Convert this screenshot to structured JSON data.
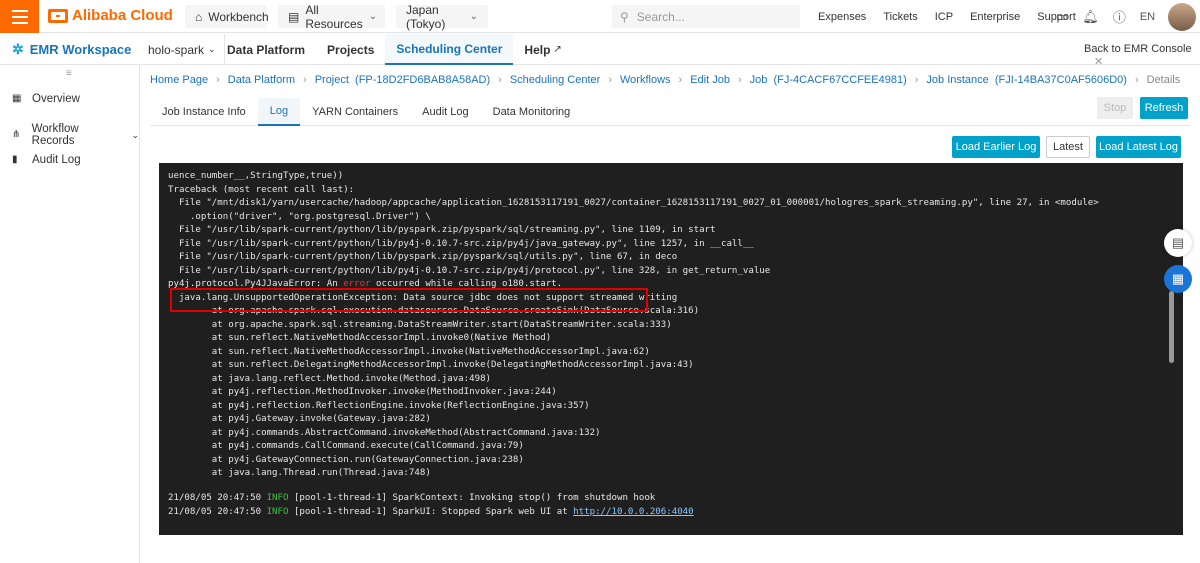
{
  "topbar": {
    "brand": "Alibaba Cloud",
    "workbench": "Workbench",
    "resources": "All Resources",
    "region": "Japan (Tokyo)",
    "search_placeholder": "Search...",
    "links": [
      "Expenses",
      "Tickets",
      "ICP",
      "Enterprise",
      "Support"
    ],
    "lang": "EN"
  },
  "secbar": {
    "product": "EMR Workspace",
    "workspace": "holo-spark",
    "tabs": [
      "Data Platform",
      "Projects",
      "Scheduling Center",
      "Help"
    ],
    "active_tab": "Scheduling Center",
    "back": "Back to EMR Console"
  },
  "sidebar": {
    "items": [
      "Overview",
      "Workflow Records",
      "Audit Log"
    ]
  },
  "breadcrumb": [
    "Home Page",
    "Data Platform",
    "Project  (FP-18D2FD6BAB8A58AD)",
    "Scheduling Center",
    "Workflows",
    "Edit Job",
    "Job  (FJ-4CACF67CCFEE4981)",
    "Job Instance  (FJI-14BA37C0AF5606D0)",
    "Details"
  ],
  "subtabs": [
    "Job Instance Info",
    "Log",
    "YARN Containers",
    "Audit Log",
    "Data Monitoring"
  ],
  "active_subtab": "Log",
  "buttons": {
    "stop": "Stop",
    "refresh": "Refresh",
    "load_earlier": "Load Earlier Log",
    "latest": "Latest",
    "load_latest": "Load Latest Log"
  },
  "log": {
    "lines": [
      "uence_number__,StringType,true))",
      "Traceback (most recent call last):",
      "  File \"/mnt/disk1/yarn/usercache/hadoop/appcache/application_1628153117191_0027/container_1628153117191_0027_01_000001/hologres_spark_streaming.py\", line 27, in <module>",
      "    .option(\"driver\", \"org.postgresql.Driver\") \\",
      "  File \"/usr/lib/spark-current/python/lib/pyspark.zip/pyspark/sql/streaming.py\", line 1109, in start",
      "  File \"/usr/lib/spark-current/python/lib/py4j-0.10.7-src.zip/py4j/java_gateway.py\", line 1257, in __call__",
      "  File \"/usr/lib/spark-current/python/lib/pyspark.zip/pyspark/sql/utils.py\", line 67, in deco",
      "  File \"/usr/lib/spark-current/python/lib/py4j-0.10.7-src.zip/py4j/protocol.py\", line 328, in get_return_value",
      "py4j.protocol.Py4JJavaError: An error occurred while calling o180.start.",
      "  java.lang.UnsupportedOperationException: Data source jdbc does not support streamed writing",
      "        at org.apache.spark.sql.execution.datasources.DataSource.createSink(DataSource.scala:316)",
      "        at org.apache.spark.sql.streaming.DataStreamWriter.start(DataStreamWriter.scala:333)",
      "        at sun.reflect.NativeMethodAccessorImpl.invoke0(Native Method)",
      "        at sun.reflect.NativeMethodAccessorImpl.invoke(NativeMethodAccessorImpl.java:62)",
      "        at sun.reflect.DelegatingMethodAccessorImpl.invoke(DelegatingMethodAccessorImpl.java:43)",
      "        at java.lang.reflect.Method.invoke(Method.java:498)",
      "        at py4j.reflection.MethodInvoker.invoke(MethodInvoker.java:244)",
      "        at py4j.reflection.ReflectionEngine.invoke(ReflectionEngine.java:357)",
      "        at py4j.Gateway.invoke(Gateway.java:282)",
      "        at py4j.commands.AbstractCommand.invokeMethod(AbstractCommand.java:132)",
      "        at py4j.commands.CallCommand.execute(CallCommand.java:79)",
      "        at py4j.GatewayConnection.run(GatewayConnection.java:238)",
      "        at java.lang.Thread.run(Thread.java:748)"
    ],
    "tail": [
      {
        "ts": "21/08/05 20:47:50",
        "level": "INFO",
        "msg": " [pool-1-thread-1] SparkContext: Invoking stop() from shutdown hook",
        "link": ""
      },
      {
        "ts": "21/08/05 20:47:50",
        "level": "INFO",
        "msg": " [pool-1-thread-1] SparkUI: Stopped Spark web UI at ",
        "link": "http://10.0.0.206:4040"
      }
    ]
  }
}
